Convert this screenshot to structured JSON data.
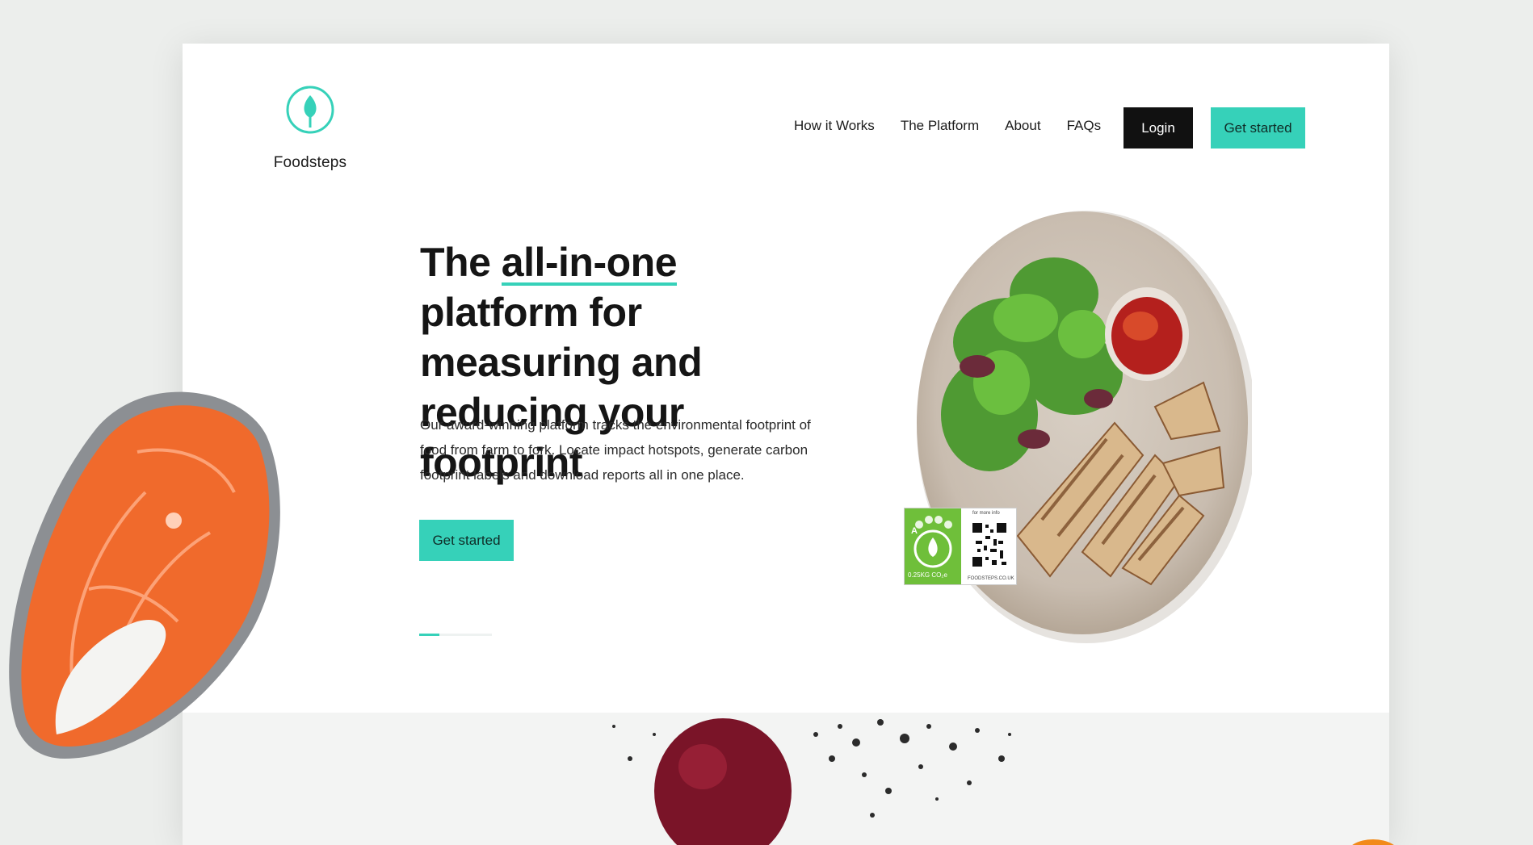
{
  "brand": {
    "name": "Foodsteps",
    "accent_color": "#36d1b9",
    "logo_icon": "leaf-in-circle-icon"
  },
  "nav": {
    "links": [
      "How it Works",
      "The Platform",
      "About",
      "FAQs"
    ],
    "login_label": "Login",
    "get_started_label": "Get started"
  },
  "hero": {
    "title_pre": "The ",
    "title_highlight": "all-in-one",
    "title_post": " platform for measuring and reducing your footprint",
    "description": "Our award-winning platform tracks the environmental footprint of food from farm to fork. Locate impact hotspots, generate carbon footprint labels and download reports all in one place.",
    "cta_label": "Get started",
    "slider_progress": 0.28
  },
  "carbon_label": {
    "value_text": "0.25KG CO₂e",
    "grade": "A",
    "qr_caption_top": "for more info",
    "qr_caption_bottom": "FOODSTEPS.CO.UK",
    "green_color": "#6fbf3a"
  },
  "colors": {
    "page_bg": "#eceeec",
    "card_bg": "#ffffff",
    "login_bg": "#111111"
  }
}
